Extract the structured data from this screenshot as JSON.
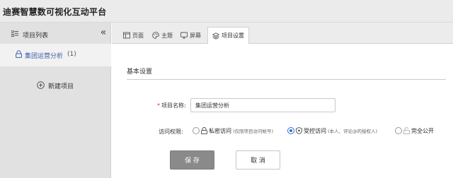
{
  "app": {
    "title": "迪赛智慧数可视化互动平台"
  },
  "sidebar": {
    "title": "项目列表",
    "projects": [
      {
        "name": "集团运营分析",
        "count": "(1)"
      }
    ],
    "new_project_label": "新建项目"
  },
  "tabs": [
    {
      "label": "页面",
      "icon": "page-icon"
    },
    {
      "label": "主题",
      "icon": "palette-icon"
    },
    {
      "label": "屏幕",
      "icon": "screen-icon"
    },
    {
      "label": "项目设置",
      "icon": "layers-icon",
      "active": true
    }
  ],
  "settings": {
    "section_title": "基本设置",
    "name_label": "项目名称:",
    "required_mark": "*",
    "name_value": "集团运营分析",
    "access_label": "访问权限:",
    "access_options": [
      {
        "label": "私密访问",
        "note": "(仅限项目访问帐号)",
        "icon": "lock-icon",
        "checked": false
      },
      {
        "label": "受控访问",
        "note": "(本人、评论@的授权人)",
        "icon": "shield-icon",
        "checked": true
      },
      {
        "label": "完全公开",
        "note": "",
        "icon": "unlock-icon",
        "checked": false
      }
    ],
    "save_label": "保 存",
    "cancel_label": "取 消"
  },
  "colors": {
    "accent": "#2d6fd6",
    "link": "#3a5ea8",
    "required": "#dd3333",
    "save_button": "#8a8a8a"
  }
}
